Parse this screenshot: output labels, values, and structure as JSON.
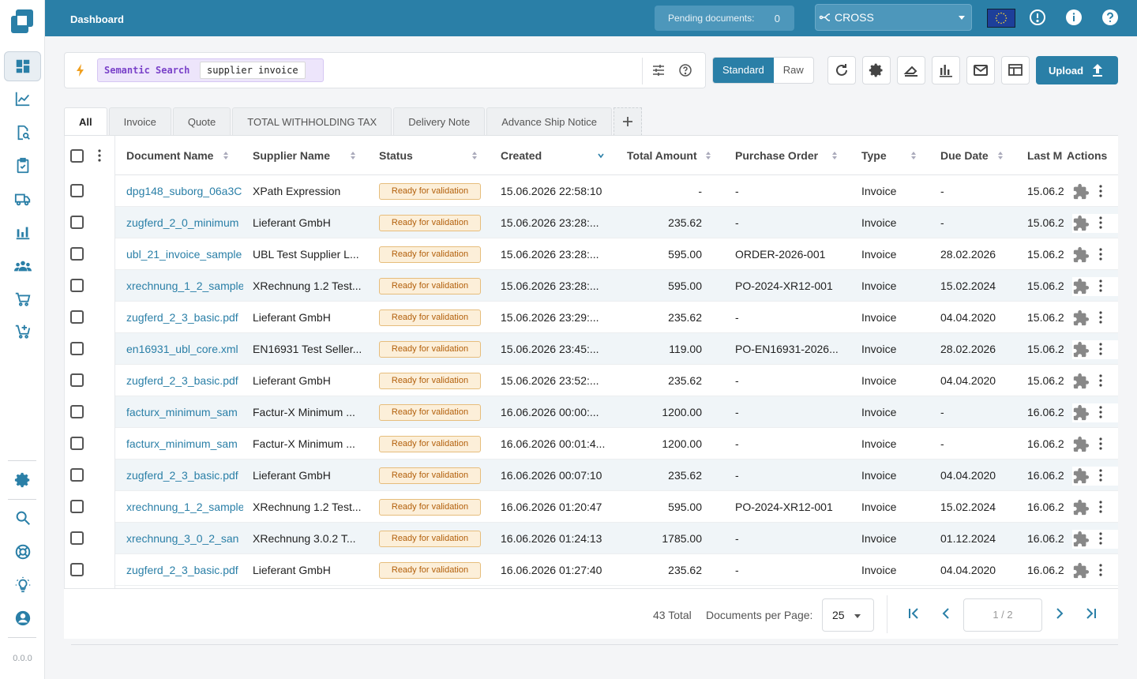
{
  "app": {
    "version": "0.0.0"
  },
  "topbar": {
    "title": "Dashboard",
    "pending_label": "Pending documents:",
    "pending_count": "0",
    "tenant": "CROSS"
  },
  "search": {
    "mode_label": "Semantic Search",
    "query": "supplier invoice"
  },
  "view_toggle": {
    "standard": "Standard",
    "raw": "Raw",
    "selected": "Standard"
  },
  "upload_label": "Upload",
  "tabs": [
    "All",
    "Invoice",
    "Quote",
    "TOTAL WITHHOLDING TAX",
    "Delivery Note",
    "Advance Ship Notice"
  ],
  "active_tab": "All",
  "columns": [
    "Document Name",
    "Supplier Name",
    "Status",
    "Created",
    "Total Amount",
    "Purchase Order",
    "Type",
    "Due Date",
    "Last M",
    "Actions"
  ],
  "rows": [
    {
      "name": "dpg148_suborg_06a3C",
      "supplier": "XPath Expression",
      "status": "Ready for validation",
      "created": "15.06.2026 22:58:10",
      "amount": "-",
      "po": "-",
      "type": "Invoice",
      "due": "-",
      "last": "15.06.2"
    },
    {
      "name": "zugferd_2_0_minimum",
      "supplier": "Lieferant GmbH",
      "status": "Ready for validation",
      "created": "15.06.2026 23:28:...",
      "amount": "235.62",
      "po": "-",
      "type": "Invoice",
      "due": "-",
      "last": "15.06.2"
    },
    {
      "name": "ubl_21_invoice_sample",
      "supplier": "UBL Test Supplier L...",
      "status": "Ready for validation",
      "created": "15.06.2026 23:28:...",
      "amount": "595.00",
      "po": "ORDER-2026-001",
      "type": "Invoice",
      "due": "28.02.2026",
      "last": "15.06.2"
    },
    {
      "name": "xrechnung_1_2_sample",
      "supplier": "XRechnung 1.2 Test...",
      "status": "Ready for validation",
      "created": "15.06.2026 23:28:...",
      "amount": "595.00",
      "po": "PO-2024-XR12-001",
      "type": "Invoice",
      "due": "15.02.2024",
      "last": "15.06.2"
    },
    {
      "name": "zugferd_2_3_basic.pdf",
      "supplier": "Lieferant GmbH",
      "status": "Ready for validation",
      "created": "15.06.2026 23:29:...",
      "amount": "235.62",
      "po": "-",
      "type": "Invoice",
      "due": "04.04.2020",
      "last": "15.06.2"
    },
    {
      "name": "en16931_ubl_core.xml",
      "supplier": "EN16931 Test Seller...",
      "status": "Ready for validation",
      "created": "15.06.2026 23:45:...",
      "amount": "119.00",
      "po": "PO-EN16931-2026...",
      "type": "Invoice",
      "due": "28.02.2026",
      "last": "15.06.2"
    },
    {
      "name": "zugferd_2_3_basic.pdf",
      "supplier": "Lieferant GmbH",
      "status": "Ready for validation",
      "created": "15.06.2026 23:52:...",
      "amount": "235.62",
      "po": "-",
      "type": "Invoice",
      "due": "04.04.2020",
      "last": "15.06.2"
    },
    {
      "name": "facturx_minimum_sam",
      "supplier": "Factur-X Minimum ...",
      "status": "Ready for validation",
      "created": "16.06.2026 00:00:...",
      "amount": "1200.00",
      "po": "-",
      "type": "Invoice",
      "due": "-",
      "last": "16.06.2"
    },
    {
      "name": "facturx_minimum_sam",
      "supplier": "Factur-X Minimum ...",
      "status": "Ready for validation",
      "created": "16.06.2026 00:01:4...",
      "amount": "1200.00",
      "po": "-",
      "type": "Invoice",
      "due": "-",
      "last": "16.06.2"
    },
    {
      "name": "zugferd_2_3_basic.pdf",
      "supplier": "Lieferant GmbH",
      "status": "Ready for validation",
      "created": "16.06.2026 00:07:10",
      "amount": "235.62",
      "po": "-",
      "type": "Invoice",
      "due": "04.04.2020",
      "last": "16.06.2"
    },
    {
      "name": "xrechnung_1_2_sample",
      "supplier": "XRechnung 1.2 Test...",
      "status": "Ready for validation",
      "created": "16.06.2026 01:20:47",
      "amount": "595.00",
      "po": "PO-2024-XR12-001",
      "type": "Invoice",
      "due": "15.02.2024",
      "last": "16.06.2"
    },
    {
      "name": "xrechnung_3_0_2_san",
      "supplier": "XRechnung 3.0.2 T...",
      "status": "Ready for validation",
      "created": "16.06.2026 01:24:13",
      "amount": "1785.00",
      "po": "-",
      "type": "Invoice",
      "due": "01.12.2024",
      "last": "16.06.2"
    },
    {
      "name": "zugferd_2_3_basic.pdf",
      "supplier": "Lieferant GmbH",
      "status": "Ready for validation",
      "created": "16.06.2026 01:27:40",
      "amount": "235.62",
      "po": "-",
      "type": "Invoice",
      "due": "04.04.2020",
      "last": "16.06.2"
    }
  ],
  "pagination": {
    "total": "43 Total",
    "per_page_label": "Documents per Page:",
    "per_page": "25",
    "page": "1 / 2"
  },
  "colors": {
    "primary": "#2a7fa7",
    "badge_bg": "#fcefd9",
    "badge_text": "#b25f0a",
    "search_bg": "#ede5fb"
  }
}
